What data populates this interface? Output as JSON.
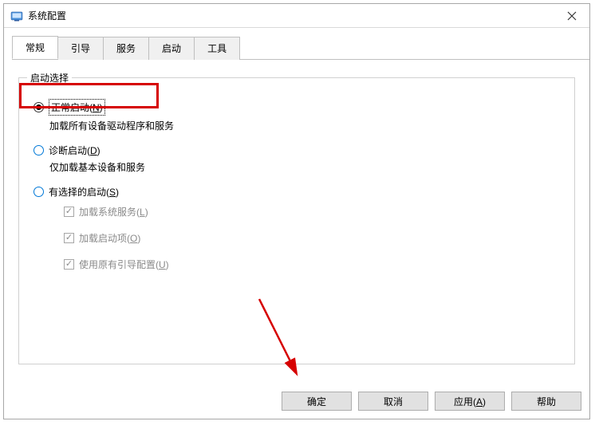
{
  "window": {
    "title": "系统配置"
  },
  "tabs": {
    "general": "常规",
    "boot": "引导",
    "services": "服务",
    "startup": "启动",
    "tools": "工具"
  },
  "group": {
    "title": "启动选择",
    "normal": {
      "prefix": "正常启动(",
      "hot": "N",
      "suffix": ")",
      "desc": "加载所有设备驱动程序和服务"
    },
    "diagnostic": {
      "prefix": "诊断启动(",
      "hot": "D",
      "suffix": ")",
      "desc": "仅加载基本设备和服务"
    },
    "selective": {
      "prefix": "有选择的启动(",
      "hot": "S",
      "suffix": ")"
    },
    "checks": {
      "sysservices": {
        "prefix": "加载系统服务(",
        "hot": "L",
        "suffix": ")"
      },
      "startupitems": {
        "prefix": "加载启动项(",
        "hot": "O",
        "suffix": ")"
      },
      "origboot": {
        "prefix": "使用原有引导配置(",
        "hot": "U",
        "suffix": ")"
      }
    }
  },
  "buttons": {
    "ok": "确定",
    "cancel": "取消",
    "apply": {
      "prefix": "应用(",
      "hot": "A",
      "suffix": ")"
    },
    "help": "帮助"
  }
}
